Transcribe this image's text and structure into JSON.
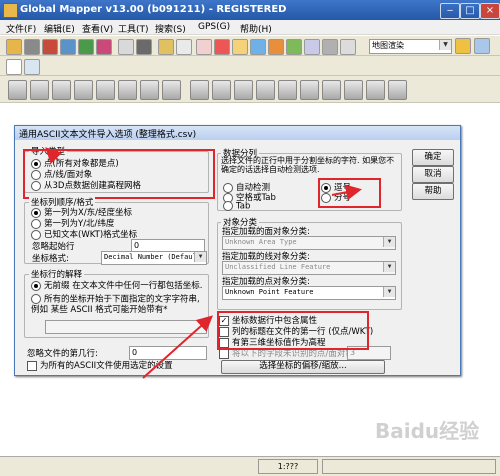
{
  "window": {
    "title": "Global Mapper v13.00 (b091211) - REGISTERED"
  },
  "menu": [
    "文件(F)",
    "编辑(E)",
    "查看(V)",
    "工具(T)",
    "搜索(S)",
    "GPS(G)",
    "帮助(H)"
  ],
  "toolbar": {
    "render_mode": "地图渲染"
  },
  "dialog": {
    "title": "通用ASCII文本文件导入选项 (整理格式.csv)",
    "buttons": {
      "ok": "确定",
      "cancel": "取消",
      "help": "帮助"
    },
    "import_type": {
      "legend": "导入类型",
      "options": [
        "点(所有对象都是点)",
        "点/线/面对象",
        "从3D点数据创建高程网格"
      ],
      "selected": 0
    },
    "coord_order": {
      "legend": "坐标列顺序/格式",
      "options": [
        "第一列为X/东/经度坐标",
        "第一列为Y/北/纬度",
        "已知文本(WKT)格式坐标"
      ],
      "selected": 0,
      "skip_label": "忽略起始行",
      "skip_value": "0",
      "format_label": "坐标格式:",
      "format_value": "Decimal Number (Defaul"
    },
    "separator": {
      "legend": "数据分列",
      "hint": "选择文件的正行中用于分割坐标的字符. 如果您不确定的话选择自动检测选项.",
      "options": [
        "自动检测",
        "逗号",
        "空格或Tab",
        "分号",
        "Tab"
      ],
      "selected": 1
    },
    "feature_class": {
      "legend": "对象分类",
      "area_label": "指定加载的面对象分类:",
      "area_value": "Unknown Area Type",
      "line_label": "指定加载的线对象分类:",
      "line_value": "Unclassified Line Feature",
      "point_label": "指定加载的点对象分类:",
      "point_value": "Unknown Point Feature"
    },
    "coord_line": {
      "legend": "坐标行的解释",
      "options": [
        "无前缀 在文本文件中任何一行都包括坐标.",
        "所有的坐标开始于下面指定的文字字符串, 例如 某些 ASCII 格式可能开始带有*"
      ],
      "selected": 0
    },
    "skip_file_label": "忽略文件的第几行:",
    "skip_file_value": "0",
    "apply_all_label": "为所有的ASCII文件使用选定的设置",
    "attribute_checks": [
      {
        "label": "坐标数据行中包含属性",
        "checked": true
      },
      {
        "label": "列的标题在文件的第一行 (仅点/WKT)",
        "checked": false
      },
      {
        "label": "有第三维坐标值作为高程",
        "checked": false
      },
      {
        "label": "将以下的字段未识别的点/面对象",
        "checked": false
      }
    ],
    "dist_value": "3",
    "proj_button": "选择坐标的偏移/缩放..."
  },
  "status": {
    "scale": "1:???"
  },
  "watermark": "Baidu经验"
}
